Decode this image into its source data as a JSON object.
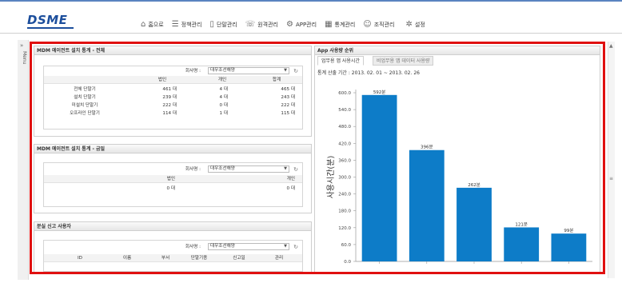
{
  "header": {
    "logo": "DSME",
    "nav": [
      {
        "label": "홈으로",
        "icon": "home-icon",
        "glyph": "⌂"
      },
      {
        "label": "정책관리",
        "icon": "policy-icon",
        "glyph": "☰"
      },
      {
        "label": "단말관리",
        "icon": "device-icon",
        "glyph": "▯"
      },
      {
        "label": "원격관리",
        "icon": "remote-icon",
        "glyph": "☏"
      },
      {
        "label": "APP관리",
        "icon": "app-icon",
        "glyph": "⚙"
      },
      {
        "label": "통계관리",
        "icon": "stats-icon",
        "glyph": "▦"
      },
      {
        "label": "조직관리",
        "icon": "org-icon",
        "glyph": "☺"
      },
      {
        "label": "설정",
        "icon": "settings-icon",
        "glyph": "✲"
      }
    ]
  },
  "rail": {
    "label": "Menu",
    "arrow": "»"
  },
  "panel1": {
    "title": "MDM 에이전트 설치 통계 - 전체",
    "company_label": "회사명 :",
    "company_value": "대우조선해양",
    "columns": [
      "",
      "법인",
      "개인",
      "합계"
    ],
    "rows": [
      {
        "name": "전체 단말기",
        "corp": "461 대",
        "personal": "4 대",
        "total": "465 대"
      },
      {
        "name": "설치 단말기",
        "corp": "239 대",
        "personal": "4 대",
        "total": "243 대"
      },
      {
        "name": "미설치 단말기",
        "corp": "222 대",
        "personal": "0 대",
        "total": "222 대"
      },
      {
        "name": "오프라인 단말기",
        "corp": "114 대",
        "personal": "1 대",
        "total": "115 대"
      }
    ]
  },
  "panel2": {
    "title": "MDM 에이전트 설치 통계 - 금일",
    "company_label": "회사명 :",
    "company_value": "대우조선해양",
    "columns": [
      "법인",
      "개인"
    ],
    "values": [
      "0 대",
      "0 대"
    ]
  },
  "panel3": {
    "title": "분실 신고 사용자",
    "company_label": "회사명 :",
    "company_value": "대우조선해양",
    "columns": [
      "ID",
      "이름",
      "부서",
      "단말기종",
      "신고일",
      "관리"
    ]
  },
  "rightpanel": {
    "title": "App 사용량 순위",
    "tabs": [
      "업무용 앱 사용시간",
      "비업무용 앱 데이터 사용량"
    ],
    "period": "통계 산출 기간 : 2013. 02. 01 ~ 2013. 02. 26"
  },
  "chart_data": {
    "type": "bar",
    "ylabel": "사용시간(분)",
    "ylim": [
      0,
      600
    ],
    "yticks": [
      "600.0",
      "540.0",
      "480.0",
      "420.0",
      "360.0",
      "300.0",
      "240.0",
      "180.0",
      "120.0",
      "60.0",
      "0.0"
    ],
    "values": [
      592,
      396,
      262,
      121,
      99
    ],
    "data_labels": [
      "592분",
      "396분",
      "262분",
      "121분",
      "99분"
    ],
    "bar_color": "#0d7cc8"
  }
}
